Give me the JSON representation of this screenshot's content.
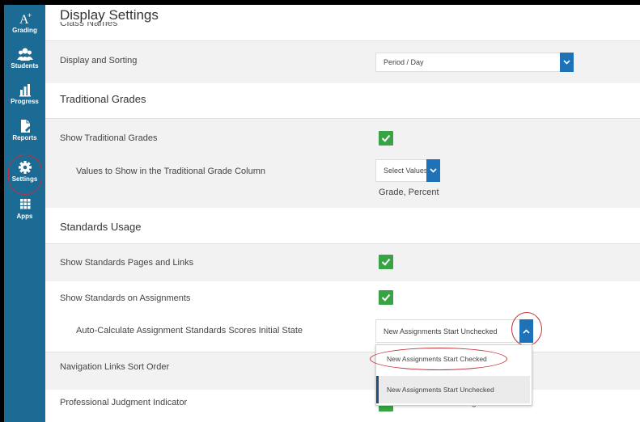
{
  "sidebar": {
    "items": [
      {
        "label": "Grading",
        "icon": "grading-icon"
      },
      {
        "label": "Students",
        "icon": "students-icon"
      },
      {
        "label": "Progress",
        "icon": "progress-icon"
      },
      {
        "label": "Reports",
        "icon": "reports-icon"
      },
      {
        "label": "Settings",
        "icon": "gear-icon",
        "active": true
      },
      {
        "label": "Apps",
        "icon": "apps-grid-icon"
      }
    ]
  },
  "page": {
    "title": "Display Settings",
    "cut_off_label": "Class Names"
  },
  "rows": {
    "display_sorting": {
      "label": "Display and Sorting",
      "value": "Period / Day"
    },
    "traditional_section": "Traditional Grades",
    "show_traditional": {
      "label": "Show Traditional Grades",
      "checked": true
    },
    "values_to_show": {
      "label": "Values to Show in the Traditional Grade Column",
      "select_placeholder": "Select Values",
      "summary": "Grade, Percent"
    },
    "standards_section": "Standards Usage",
    "show_standards_pages": {
      "label": "Show Standards Pages and Links",
      "checked": true
    },
    "show_standards_assignments": {
      "label": "Show Standards on Assignments",
      "checked": true
    },
    "auto_calc": {
      "label": "Auto-Calculate Assignment Standards Scores Initial State",
      "value": "New Assignments Start Unchecked"
    },
    "nav_sort": {
      "label": "Navigation Links Sort Order"
    },
    "professional": {
      "label": "Professional Judgment Indicator",
      "partial_text": "Show on Grading / Standards"
    }
  },
  "dropdown": {
    "options": [
      "New Assignments Start Checked",
      "New Assignments Start Unchecked"
    ],
    "selected_index": 1
  },
  "colors": {
    "sidebar": "#1b6b95",
    "accent": "#1f71b8",
    "check": "#37a344",
    "annotation": "#c0323a"
  }
}
